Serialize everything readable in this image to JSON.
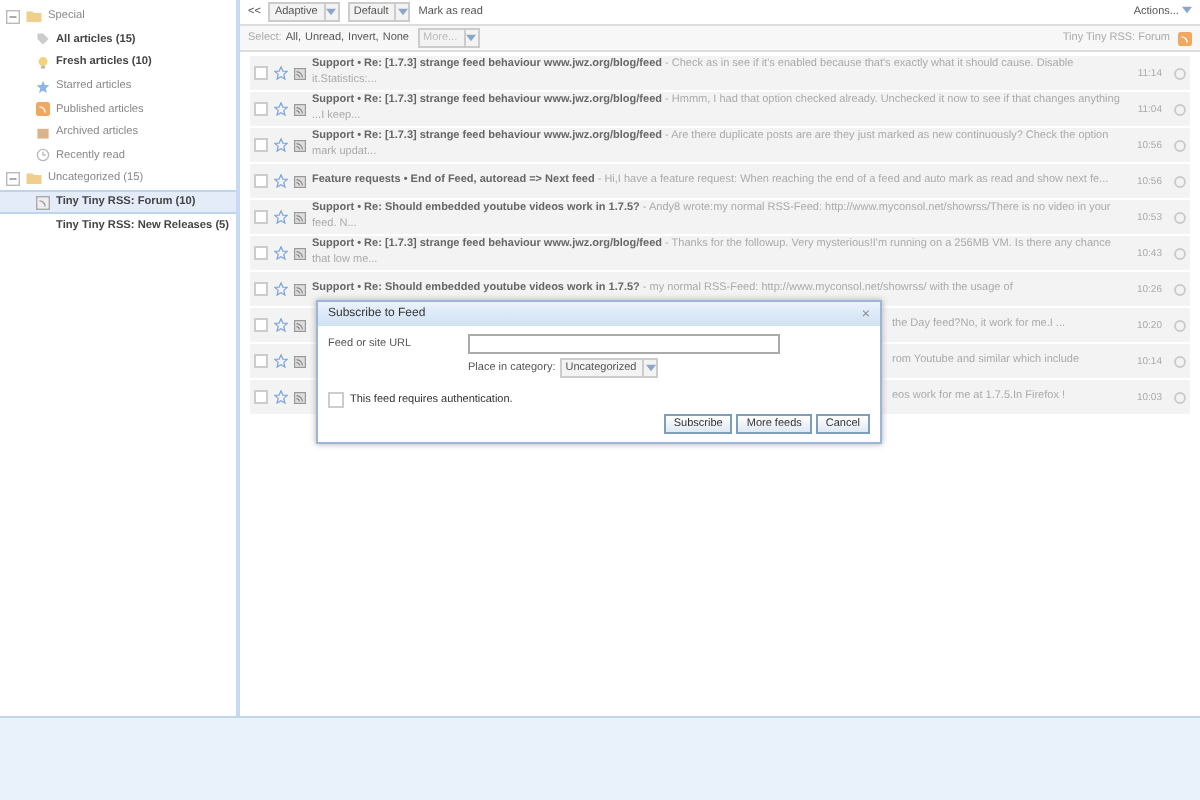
{
  "sidebar": {
    "categories": [
      {
        "label": "Special",
        "expanded": true,
        "children": [
          {
            "kind": "all",
            "label": "All articles (15)",
            "unread": true,
            "selected": false
          },
          {
            "kind": "fresh",
            "label": "Fresh articles (10)",
            "unread": true,
            "selected": false
          },
          {
            "kind": "starred",
            "label": "Starred articles",
            "unread": false,
            "selected": false
          },
          {
            "kind": "published",
            "label": "Published articles",
            "unread": false,
            "selected": false
          },
          {
            "kind": "archived",
            "label": "Archived articles",
            "unread": false,
            "selected": false
          },
          {
            "kind": "recent",
            "label": "Recently read",
            "unread": false,
            "selected": false
          }
        ]
      },
      {
        "label": "Uncategorized (15)",
        "expanded": true,
        "children": [
          {
            "kind": "feed",
            "label": "Tiny Tiny RSS: Forum (10)",
            "unread": true,
            "selected": true
          },
          {
            "kind": "plain",
            "label": "Tiny Tiny RSS: New Releases (5)",
            "unread": true,
            "selected": false
          }
        ]
      }
    ]
  },
  "toolbar": {
    "collapse": "<<",
    "view_mode": "Adaptive",
    "order": "Default",
    "mark_read": "Mark as read",
    "actions": "Actions..."
  },
  "select_bar": {
    "label": "Select:",
    "links": [
      "All,",
      "Unread,",
      "Invert,",
      "None"
    ],
    "more": "More...",
    "feed_title": "Tiny Tiny RSS: Forum"
  },
  "headlines": [
    {
      "title": "Support • Re: [1.7.3] strange feed behaviour www.jwz.org/blog/feed",
      "excerpt": " - Check as in see if it's enabled because that's exactly what it should cause. Disable it.Statistics:...",
      "time": "11:14",
      "checked": false,
      "starred": false
    },
    {
      "title": "Support • Re: [1.7.3] strange feed behaviour www.jwz.org/blog/feed",
      "excerpt": " - Hmmm, I had that option checked already. Unchecked it now to see if that changes anything ...I keep...",
      "time": "11:04",
      "checked": false,
      "starred": false
    },
    {
      "title": "Support • Re: [1.7.3] strange feed behaviour www.jwz.org/blog/feed",
      "excerpt": " - Are there duplicate posts are are they just marked as new continuously? Check the option mark updat...",
      "time": "10:56",
      "checked": false,
      "starred": false
    },
    {
      "title": "Feature requests • End of Feed, autoread => Next feed",
      "excerpt": " - Hi,I have a feature request: When reaching the end of a feed and auto mark as read and show next fe...",
      "time": "10:56",
      "checked": false,
      "starred": false
    },
    {
      "title": "Support • Re: Should embedded youtube videos work in 1.7.5?",
      "excerpt": " - Andy8 wrote:my normal RSS-Feed: http://www.myconsol.net/showrss/There is no video in your feed. N...",
      "time": "10:53",
      "checked": false,
      "starred": false
    },
    {
      "title": "Support • Re: [1.7.3] strange feed behaviour www.jwz.org/blog/feed",
      "excerpt": " - Thanks for the followup. Very mysterious!I'm running on a 256MB VM. Is there any chance that low me...",
      "time": "10:43",
      "checked": false,
      "starred": false
    },
    {
      "title": "Support • Re: Should embedded youtube videos work in 1.7.5?",
      "excerpt": " - my normal RSS-Feed: http://www.myconsol.net/showrss/ with the usage of",
      "time": "10:26",
      "checked": false,
      "starred": false
    },
    {
      "excerpt": "the Day feed?No, it work for me.I ...",
      "time": "10:20",
      "checked": false,
      "starred": false
    },
    {
      "excerpt": "rom Youtube and similar which include",
      "time": "10:14",
      "checked": false,
      "starred": false
    },
    {
      "excerpt": "eos work for me at 1.7.5.In Firefox !",
      "time": "10:03",
      "checked": false,
      "starred": false
    }
  ],
  "dialog": {
    "title": "Subscribe to Feed",
    "close": "×",
    "url_label": "Feed or site URL",
    "category_label": "Place in category:",
    "category": "Uncategorized",
    "auth_label": "This feed requires authentication.",
    "auth_checked": false,
    "buttons": [
      "Subscribe",
      "More feeds",
      "Cancel"
    ]
  }
}
